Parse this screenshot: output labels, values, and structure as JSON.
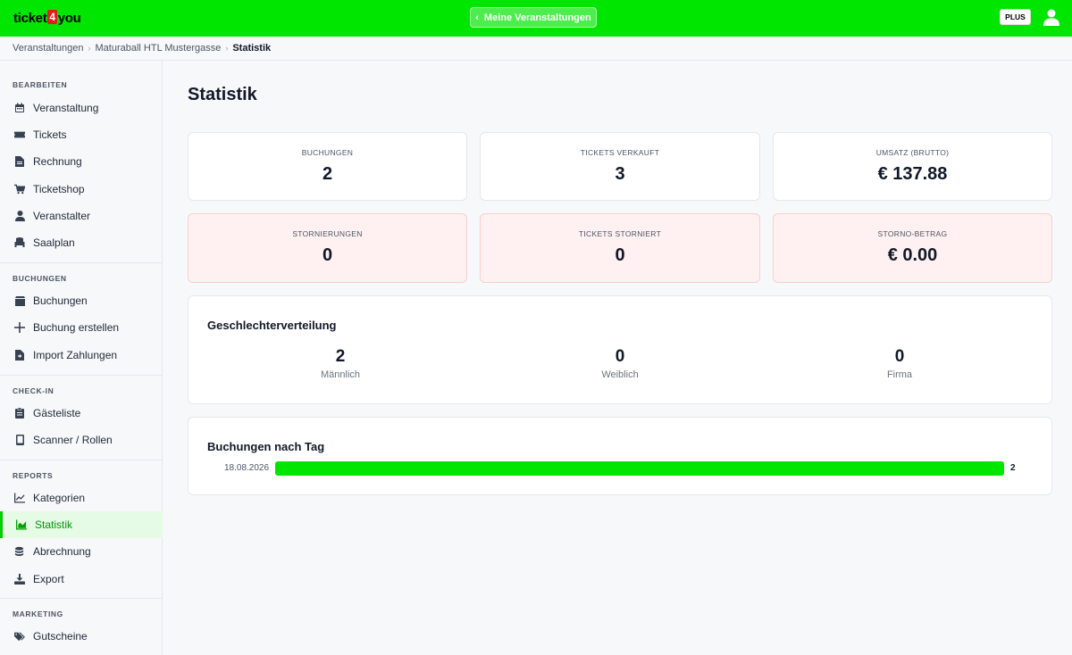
{
  "app": {
    "logo_left": "ticket",
    "logo_mid": "4",
    "logo_right": "you",
    "brand_color": "#00e600"
  },
  "header": {
    "back_button_label": "Meine Veranstaltungen",
    "plan_badge": "PLUS"
  },
  "breadcrumb": {
    "items": [
      "Veranstaltungen",
      "Maturaball HTL Mustergasse",
      "Statistik"
    ]
  },
  "sidebar": {
    "sections": [
      {
        "heading": "BEARBEITEN",
        "items": [
          {
            "label": "Veranstaltung",
            "icon": "calendar-icon"
          },
          {
            "label": "Tickets",
            "icon": "ticket-icon"
          },
          {
            "label": "Rechnung",
            "icon": "invoice-icon"
          },
          {
            "label": "Ticketshop",
            "icon": "cart-icon"
          },
          {
            "label": "Veranstalter",
            "icon": "user-icon"
          },
          {
            "label": "Saalplan",
            "icon": "chair-icon"
          }
        ]
      },
      {
        "heading": "BUCHUNGEN",
        "items": [
          {
            "label": "Buchungen",
            "icon": "box-icon"
          },
          {
            "label": "Buchung erstellen",
            "icon": "plus-icon"
          },
          {
            "label": "Import Zahlungen",
            "icon": "file-import-icon"
          }
        ]
      },
      {
        "heading": "CHECK-IN",
        "items": [
          {
            "label": "Gästeliste",
            "icon": "clipboard-icon"
          },
          {
            "label": "Scanner / Rollen",
            "icon": "phone-icon"
          }
        ]
      },
      {
        "heading": "REPORTS",
        "items": [
          {
            "label": "Kategorien",
            "icon": "line-chart-icon"
          },
          {
            "label": "Statistik",
            "icon": "area-chart-icon",
            "active": true
          },
          {
            "label": "Abrechnung",
            "icon": "coins-icon"
          },
          {
            "label": "Export",
            "icon": "download-icon"
          }
        ]
      },
      {
        "heading": "MARKETING",
        "items": [
          {
            "label": "Gutscheine",
            "icon": "tags-icon"
          }
        ]
      }
    ]
  },
  "main": {
    "title": "Statistik",
    "stats": [
      {
        "label": "BUCHUNGEN",
        "value": "2"
      },
      {
        "label": "TICKETS VERKAUFT",
        "value": "3"
      },
      {
        "label": "UMSATZ (BRUTTO)",
        "value": "€ 137.88"
      },
      {
        "label": "STORNIERUNGEN",
        "value": "0"
      },
      {
        "label": "TICKETS STORNIERT",
        "value": "0"
      },
      {
        "label": "STORNO-BETRAG",
        "value": "€ 0.00"
      }
    ],
    "gender": {
      "title": "Geschlechterverteilung",
      "items": [
        {
          "value": "2",
          "label": "Männlich"
        },
        {
          "value": "0",
          "label": "Weiblich"
        },
        {
          "value": "0",
          "label": "Firma"
        }
      ]
    },
    "by_day": {
      "title": "Buchungen nach Tag",
      "rows": [
        {
          "date": "18.08.2026",
          "count": "2",
          "fraction": 1.0
        }
      ]
    }
  }
}
